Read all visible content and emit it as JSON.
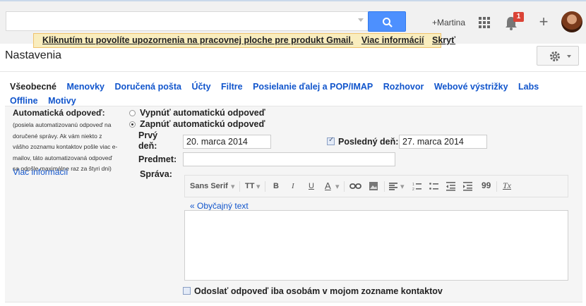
{
  "header": {
    "search": {
      "value": "",
      "placeholder": ""
    },
    "user_label": "+Martina",
    "notification_count": "1",
    "plus_symbol": "+"
  },
  "notice": {
    "message": "Kliknutím tu povolíte upozornenia na pracovnej ploche pre produkt Gmail.",
    "more_info": "Viac informácií",
    "hide": "Skryť"
  },
  "page": {
    "title": "Nastavenia"
  },
  "tabs": [
    {
      "label": "Všeobecné"
    },
    {
      "label": "Menovky"
    },
    {
      "label": "Doručená pošta"
    },
    {
      "label": "Účty"
    },
    {
      "label": "Filtre"
    },
    {
      "label": "Posielanie ďalej a POP/IMAP"
    },
    {
      "label": "Rozhovor"
    },
    {
      "label": "Webové výstrižky"
    },
    {
      "label": "Labs"
    },
    {
      "label": "Offline"
    },
    {
      "label": "Motivy"
    }
  ],
  "auto_reply": {
    "label": "Automatická odpoveď:",
    "help": "(posiela automatizovanú odpoveď na doručené správy. Ak vám niekto z vášho zoznamu kontaktov pošle viac e-mailov, táto automatizovaná odpoveď sa odošle maximálne raz za štyri dni)",
    "more_info": "Viac informácií",
    "off_label": "Vypnúť automatickú odpoveď",
    "on_label": "Zapnúť automatickú odpoveď",
    "first_day_label": "Prvý deň:",
    "first_day_value": "20. marca 2014",
    "last_day_label": "Posledný deň:",
    "last_day_value": "27. marca 2014",
    "last_day_checked": true,
    "subject_label": "Predmet:",
    "subject_value": "",
    "message_label": "Správa:",
    "plain_text_link": "« Obyčajný text",
    "contacts_only_label": "Odoslať odpoveď iba osobám v mojom zozname kontaktov"
  },
  "toolbar": {
    "font": "Sans Serif",
    "size_icon": "TT",
    "bold": "B",
    "italic": "I",
    "underline": "U",
    "text_color": "A",
    "quote": "99",
    "clear": "Tx"
  }
}
